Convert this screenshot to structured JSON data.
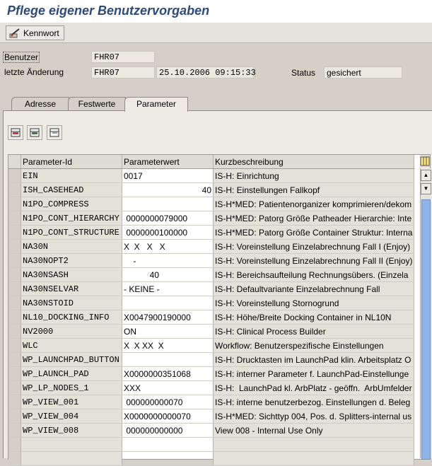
{
  "title": "Pflege eigener Benutzervorgaben",
  "toolbar": {
    "kennwort_label": "Kennwort",
    "icon": "key-pen-icon"
  },
  "header": {
    "benutzer_label": "Benutzer",
    "benutzer_value": "FHR07",
    "aenderung_label": "letzte Änderung",
    "aenderung_user": "FHR07",
    "aenderung_datetime": "25.10.2006 09:15:33",
    "status_label": "Status",
    "status_value": "gesichert"
  },
  "tabs": [
    {
      "label": "Adresse",
      "active": false
    },
    {
      "label": "Festwerte",
      "active": false
    },
    {
      "label": "Parameter",
      "active": true
    }
  ],
  "table": {
    "columns": [
      "Parameter-Id",
      "Parameterwert",
      "Kurzbeschreibung"
    ],
    "rows": [
      {
        "id": "EIN",
        "value": "0017",
        "desc": "IS-H: Einrichtung",
        "align": "left"
      },
      {
        "id": "ISH_CASEHEAD",
        "value": "40",
        "desc": "IS-H: Einstellungen Fallkopf",
        "align": "right"
      },
      {
        "id": "N1PO_COMPRESS",
        "value": "",
        "desc": "IS-H*MED: Patientenorganizer komprimieren/dekom",
        "align": "left"
      },
      {
        "id": "N1PO_CONT_HIERARCHY",
        "value": " 0000000079000",
        "desc": "IS-H*MED: Patorg Größe Patheader Hierarchie: Inte",
        "align": "left"
      },
      {
        "id": "N1PO_CONT_STRUCTURE",
        "value": " 0000000100000",
        "desc": "IS-H*MED: Patorg Größe Container Struktur: Interna",
        "align": "left"
      },
      {
        "id": "NA30N",
        "value": "X  X   X   X",
        "desc": "IS-H: Voreinstellung Einzelabrechnung Fall I (Enjoy)",
        "align": "left"
      },
      {
        "id": "NA30NOPT2",
        "value": "    -",
        "desc": "IS-H: Voreinstellung Einzelabrechnung Fall II (Enjoy)",
        "align": "left"
      },
      {
        "id": "NA30NSASH",
        "value": "           40",
        "desc": "IS-H: Bereichsaufteilung Rechnungsübers. (Einzela",
        "align": "left"
      },
      {
        "id": "NA30NSELVAR",
        "value": "- KEINE -",
        "desc": "IS-H: Defaultvariante Einzelabrechnung Fall",
        "align": "left"
      },
      {
        "id": "NA30NSTOID",
        "value": "",
        "desc": "IS-H: Voreinstellung Stornogrund",
        "align": "left"
      },
      {
        "id": "NL10_DOCKING_INFO",
        "value": "X0047900190000",
        "desc": "IS-H: Höhe/Breite Docking Container in NL10N",
        "align": "left"
      },
      {
        "id": "NV2000",
        "value": "ON",
        "desc": "IS-H: Clinical Process Builder",
        "align": "left"
      },
      {
        "id": "WLC",
        "value": "X  X XX  X",
        "desc": "Workflow: Benutzerspezifische Einstellungen",
        "align": "left"
      },
      {
        "id": "WP_LAUNCHPAD_BUTTON",
        "value": "",
        "desc": "IS-H: Drucktasten im LaunchPad klin. Arbeitsplatz O",
        "align": "left"
      },
      {
        "id": "WP_LAUNCH_PAD",
        "value": "X0000000351068",
        "desc": "IS-H: interner Parameter f. LaunchPad-Einstellunge",
        "align": "left"
      },
      {
        "id": "WP_LP_NODES_1",
        "value": "XXX",
        "desc": "IS-H:  LaunchPad kl. ArbPlatz - geöffn.  ArbUmfelder",
        "align": "left"
      },
      {
        "id": "WP_VIEW_001",
        "value": " 000000000070",
        "desc": "IS-H: interne benutzerbezog. Einstellungen d. Beleg",
        "align": "left"
      },
      {
        "id": "WP_VIEW_004",
        "value": "X0000000000070",
        "desc": "IS-H*MED: Sichttyp 004, Pos. d. Splitters-internal us",
        "align": "left"
      },
      {
        "id": "WP_VIEW_008",
        "value": " 000000000000",
        "desc": "View 008 - Internal Use Only",
        "align": "left"
      },
      {
        "id": "",
        "value": "",
        "desc": "",
        "align": "left"
      },
      {
        "id": "",
        "value": "",
        "desc": "",
        "align": "left"
      }
    ]
  },
  "icons": {
    "btn1": "insert-row-icon",
    "btn2": "append-row-icon",
    "btn3": "delete-row-icon",
    "grid_settings": "layout-grid-icon",
    "scroll_up": "scroll-up-icon",
    "scroll_down": "scroll-down-icon"
  }
}
